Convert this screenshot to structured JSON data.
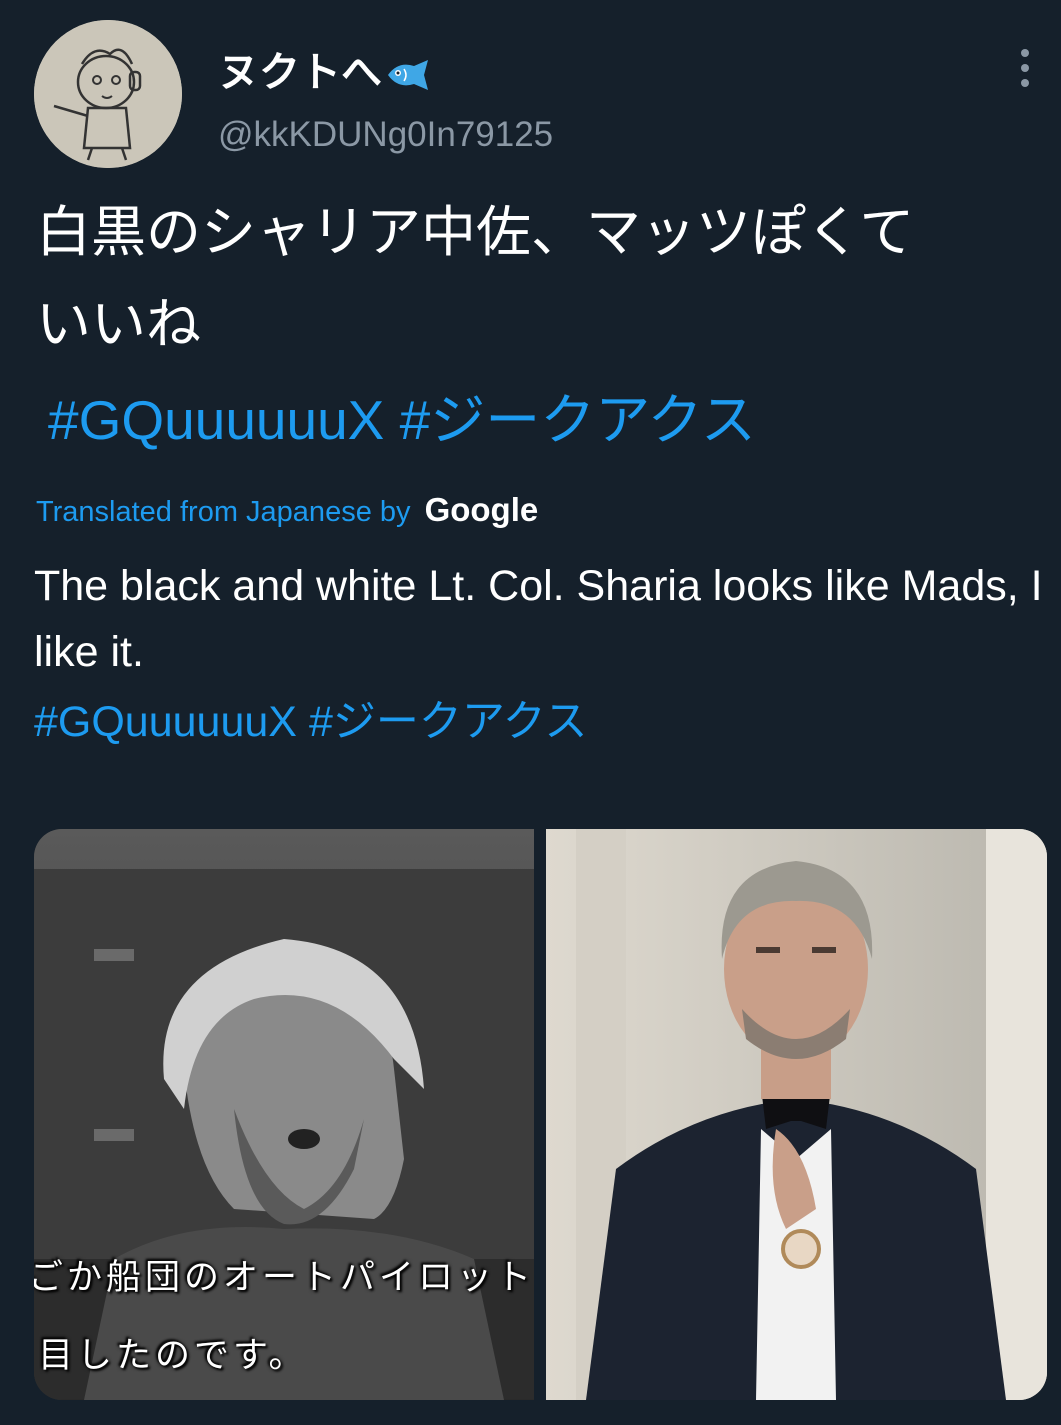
{
  "user": {
    "display_name": "ヌクトへ",
    "handle": "@kkKDUNg0In79125",
    "avatar_icon": "avatar-sketch-icon",
    "badge_icon": "fish-icon"
  },
  "menu": {
    "icon": "more-vertical-icon"
  },
  "tweet": {
    "text": "白黒のシャリア中佐、マッツぽくて\nいいね",
    "hashtags": [
      "#GQuuuuuuX",
      "#ジークアクス"
    ]
  },
  "translation": {
    "label": "Translated from Japanese by",
    "provider": "Google",
    "text": "The black and white Lt. Col. Sharia looks like Mads, I like it.",
    "hashtags": [
      "#GQuuuuuuX",
      "#ジークアクス"
    ]
  },
  "media": [
    {
      "kind": "anime-screenshot",
      "subtitles": [
        "ごか船団のオートパイロット",
        "目したのです。"
      ]
    },
    {
      "kind": "photo"
    }
  ],
  "colors": {
    "background": "#15202b",
    "text": "#ffffff",
    "secondary": "#8b98a5",
    "link": "#1d9bf0"
  }
}
